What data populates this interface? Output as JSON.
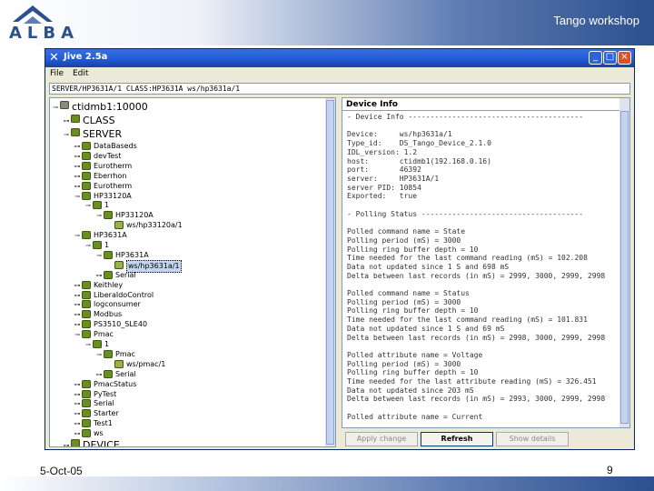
{
  "slide": {
    "logo_text": "ALBA",
    "header_title": "Tango workshop",
    "date": "5-Oct-05",
    "page_number": "9",
    "colors": {
      "header_dark": "#2c4f8e",
      "window_title": "#245edb"
    }
  },
  "window": {
    "title": "Jive 2.5a",
    "app_icon": "jive-x-icon",
    "buttons": {
      "minimize": "_",
      "maximize": "□",
      "close": "×"
    },
    "menu": [
      "File",
      "Edit"
    ],
    "path": "SERVER/HP3631A/1 CLASS:HP3631A ws/hp3631a/1"
  },
  "tree": {
    "items": [
      {
        "label": "ctidmb1:10000",
        "level": 0,
        "expanded": true,
        "icon": "host-icon",
        "big": true
      },
      {
        "label": "CLASS",
        "level": 1,
        "expanded": false,
        "icon": "folder-icon",
        "big": true
      },
      {
        "label": "SERVER",
        "level": 1,
        "expanded": true,
        "icon": "folder-icon",
        "big": true
      },
      {
        "label": "DataBaseds",
        "level": 2,
        "expanded": false,
        "icon": "server-icon"
      },
      {
        "label": "devTest",
        "level": 2,
        "expanded": false,
        "icon": "server-icon"
      },
      {
        "label": "Eurotherm",
        "level": 2,
        "expanded": false,
        "icon": "server-icon"
      },
      {
        "label": "Eberrhon",
        "level": 2,
        "expanded": false,
        "icon": "server-icon"
      },
      {
        "label": "Eurotherm",
        "level": 2,
        "expanded": false,
        "icon": "server-icon"
      },
      {
        "label": "HP33120A",
        "level": 2,
        "expanded": true,
        "icon": "server-icon"
      },
      {
        "label": "1",
        "level": 3,
        "expanded": true,
        "icon": "instance-icon"
      },
      {
        "label": "HP33120A",
        "level": 4,
        "expanded": true,
        "icon": "class-icon"
      },
      {
        "label": "ws/hp33120a/1",
        "level": 5,
        "expanded": null,
        "icon": "device-icon"
      },
      {
        "label": "HP3631A",
        "level": 2,
        "expanded": true,
        "icon": "server-icon"
      },
      {
        "label": "1",
        "level": 3,
        "expanded": true,
        "icon": "instance-icon"
      },
      {
        "label": "HP3631A",
        "level": 4,
        "expanded": true,
        "icon": "class-icon"
      },
      {
        "label": "ws/hp3631a/1",
        "level": 5,
        "expanded": null,
        "icon": "device-icon",
        "selected": true
      },
      {
        "label": "Serial",
        "level": 4,
        "expanded": false,
        "icon": "class-icon"
      },
      {
        "label": "Keithley",
        "level": 2,
        "expanded": false,
        "icon": "server-icon"
      },
      {
        "label": "LiberaIdoControl",
        "level": 2,
        "expanded": false,
        "icon": "server-icon"
      },
      {
        "label": "logconsumer",
        "level": 2,
        "expanded": false,
        "icon": "server-icon"
      },
      {
        "label": "Modbus",
        "level": 2,
        "expanded": false,
        "icon": "server-icon"
      },
      {
        "label": "PS3510_SLE40",
        "level": 2,
        "expanded": false,
        "icon": "server-icon"
      },
      {
        "label": "Pmac",
        "level": 2,
        "expanded": true,
        "icon": "server-icon"
      },
      {
        "label": "1",
        "level": 3,
        "expanded": true,
        "icon": "instance-icon"
      },
      {
        "label": "Pmac",
        "level": 4,
        "expanded": true,
        "icon": "class-icon"
      },
      {
        "label": "ws/pmac/1",
        "level": 5,
        "expanded": null,
        "icon": "device-icon"
      },
      {
        "label": "Serial",
        "level": 4,
        "expanded": false,
        "icon": "class-icon"
      },
      {
        "label": "PmacStatus",
        "level": 2,
        "expanded": false,
        "icon": "server-icon"
      },
      {
        "label": "PyTest",
        "level": 2,
        "expanded": false,
        "icon": "server-icon"
      },
      {
        "label": "Serial",
        "level": 2,
        "expanded": false,
        "icon": "server-icon"
      },
      {
        "label": "Starter",
        "level": 2,
        "expanded": false,
        "icon": "server-icon"
      },
      {
        "label": "Test1",
        "level": 2,
        "expanded": false,
        "icon": "server-icon"
      },
      {
        "label": "ws",
        "level": 2,
        "expanded": false,
        "icon": "server-icon"
      },
      {
        "label": "DEVICE",
        "level": 1,
        "expanded": false,
        "icon": "folder-icon",
        "big": true
      }
    ]
  },
  "info": {
    "header": "Device Info",
    "lines": [
      "- Device Info ----------------------------------------",
      "",
      "Device:     ws/hp3631a/1",
      "Type_id:    DS_Tango_Device_2.1.0",
      "IDL_version: 1.2",
      "host:       ctidmb1(192.168.0.16)",
      "port:       46392",
      "server:     HP3631A/1",
      "server PID: 10854",
      "Exported:   true",
      "",
      "- Polling Status -------------------------------------",
      "",
      "Polled command name = State",
      "Polling period (mS) = 3000",
      "Polling ring buffer depth = 10",
      "Time needed for the last command reading (mS) = 102.208",
      "Data not updated since 1 S and 698 mS",
      "Delta between last records (in mS) = 2999, 3000, 2999, 2998",
      "",
      "Polled command name = Status",
      "Polling period (mS) = 3000",
      "Polling ring buffer depth = 10",
      "Time needed for the last command reading (mS) = 101.831",
      "Data not updated since 1 S and 69 mS",
      "Delta between last records (in mS) = 2998, 3000, 2999, 2998",
      "",
      "Polled attribute name = Voltage",
      "Polling period (mS) = 3000",
      "Polling ring buffer depth = 10",
      "Time needed for the last attribute reading (mS) = 326.451",
      "Data not updated since 203 mS",
      "Delta between last records (in mS) = 2993, 3000, 2999, 2998",
      "",
      "Polled attribute name = Current"
    ],
    "buttons": [
      {
        "label": "Apply change",
        "enabled": false
      },
      {
        "label": "Refresh",
        "enabled": true
      },
      {
        "label": "Show details",
        "enabled": false
      }
    ]
  }
}
